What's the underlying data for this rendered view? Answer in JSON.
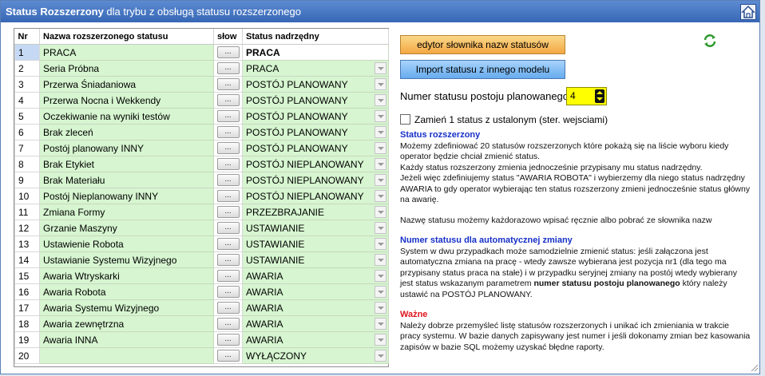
{
  "window": {
    "title_bold": "Status Rozszerzony",
    "title_rest": " dla trybu z obsługą statusu rozszerzonego"
  },
  "grid": {
    "headers": {
      "nr": "Nr",
      "name": "Nazwa rozszerzonego statusu",
      "slow": "słow",
      "parent": "Status nadrzędny"
    },
    "button_label": "...",
    "rows": [
      {
        "nr": "1",
        "name": "PRACA",
        "parent": "PRACA"
      },
      {
        "nr": "2",
        "name": "Seria Próbna",
        "parent": "PRACA"
      },
      {
        "nr": "3",
        "name": "Przerwa Śniadaniowa",
        "parent": "POSTÓJ PLANOWANY"
      },
      {
        "nr": "4",
        "name": "Przerwa Nocna i Wekkendy",
        "parent": "POSTÓJ PLANOWANY"
      },
      {
        "nr": "5",
        "name": "Oczekiwanie na wyniki testów",
        "parent": "POSTÓJ PLANOWANY"
      },
      {
        "nr": "6",
        "name": "Brak zleceń",
        "parent": "POSTÓJ PLANOWANY"
      },
      {
        "nr": "7",
        "name": "Postój planowany INNY",
        "parent": "POSTÓJ PLANOWANY"
      },
      {
        "nr": "8",
        "name": "Brak Etykiet",
        "parent": "POSTÓJ NIEPLANOWANY"
      },
      {
        "nr": "9",
        "name": "Brak Materiału",
        "parent": "POSTÓJ NIEPLANOWANY"
      },
      {
        "nr": "10",
        "name": "Postój Nieplanowany INNY",
        "parent": "POSTÓJ NIEPLANOWANY"
      },
      {
        "nr": "11",
        "name": "Zmiana Formy",
        "parent": "PRZEZBRAJANIE"
      },
      {
        "nr": "12",
        "name": "Grzanie Maszyny",
        "parent": "USTAWIANIE"
      },
      {
        "nr": "13",
        "name": "Ustawienie Robota",
        "parent": "USTAWIANIE"
      },
      {
        "nr": "14",
        "name": "Ustawianie Systemu Wizyjnego",
        "parent": "USTAWIANIE"
      },
      {
        "nr": "15",
        "name": "Awaria Wtryskarki",
        "parent": "AWARIA"
      },
      {
        "nr": "16",
        "name": "Awaria Robota",
        "parent": "AWARIA"
      },
      {
        "nr": "17",
        "name": "Awaria Systemu Wizyjnego",
        "parent": "AWARIA"
      },
      {
        "nr": "18",
        "name": "Awaria zewnętrzna",
        "parent": "AWARIA"
      },
      {
        "nr": "19",
        "name": "Awaria INNA",
        "parent": "AWARIA"
      },
      {
        "nr": "20",
        "name": "",
        "parent": "WYŁĄCZONY"
      }
    ]
  },
  "panel": {
    "dict_button": "edytor słownika nazw statusów",
    "import_button": "Import statusu z innego modelu",
    "planned_label": "Numer statusu postoju planowanego",
    "planned_value": "4",
    "checkbox_label": "Zamień 1 status z ustalonym (ster. wejsciami)",
    "info": {
      "h1": "Status rozszerzony",
      "p1": "Możemy zdefiniować 20 statusów rozszerzonych które pokażą się na liście wyboru kiedy operator będzie chciał zmienić status.",
      "p2": "Każdy status rozszerzony zmienia jednocześnie przypisany mu status nadrzędny.",
      "p3": "Jeżeli więc zdefiniujemy status \"AWARIA ROBOTA\" i wybierzemy dla niego status nadrzędny AWARIA to gdy operator wybierając ten status rozszerzony zmieni jednocześnie status główny na awarię.",
      "p4": "Nazwę statusu możemy każdorazowo wpisać ręcznie albo pobrać ze słownika nazw",
      "h2": "Numer statusu dla automatycznej zmiany",
      "p5a": "System w dwu przypadkach może samodzielnie zmienić status: jeśli załączona jest automatyczna zmiana na pracę - wtedy zawsze wybierana jest pozycja nr1 (dla tego ma przypisany status praca na stałe) i w przypadku seryjnej zmiany na postój wtedy wybierany jest status wskazanym parametrem ",
      "p5b": "numer statusu postoju planowanego",
      "p5c": " który należy ustawić na POSTÓJ PLANOWANY.",
      "h3": "Ważne",
      "p6": "Należy dobrze przemyśleć listę statusów rozszerzonych i unikać ich zmieniania w trakcie pracy systemu. W bazie danych zapisywany jest numer i jeśli dokonamy zmian bez kasowania zapisów w bazie SQL możemy uzyskać błędne raporty."
    }
  },
  "colors": {
    "title_bar": "#3f6fbf",
    "row_green": "#d6f5d0",
    "button_orange": "#f3a742",
    "button_blue": "#67abee",
    "spin_yellow": "#ffff00"
  }
}
